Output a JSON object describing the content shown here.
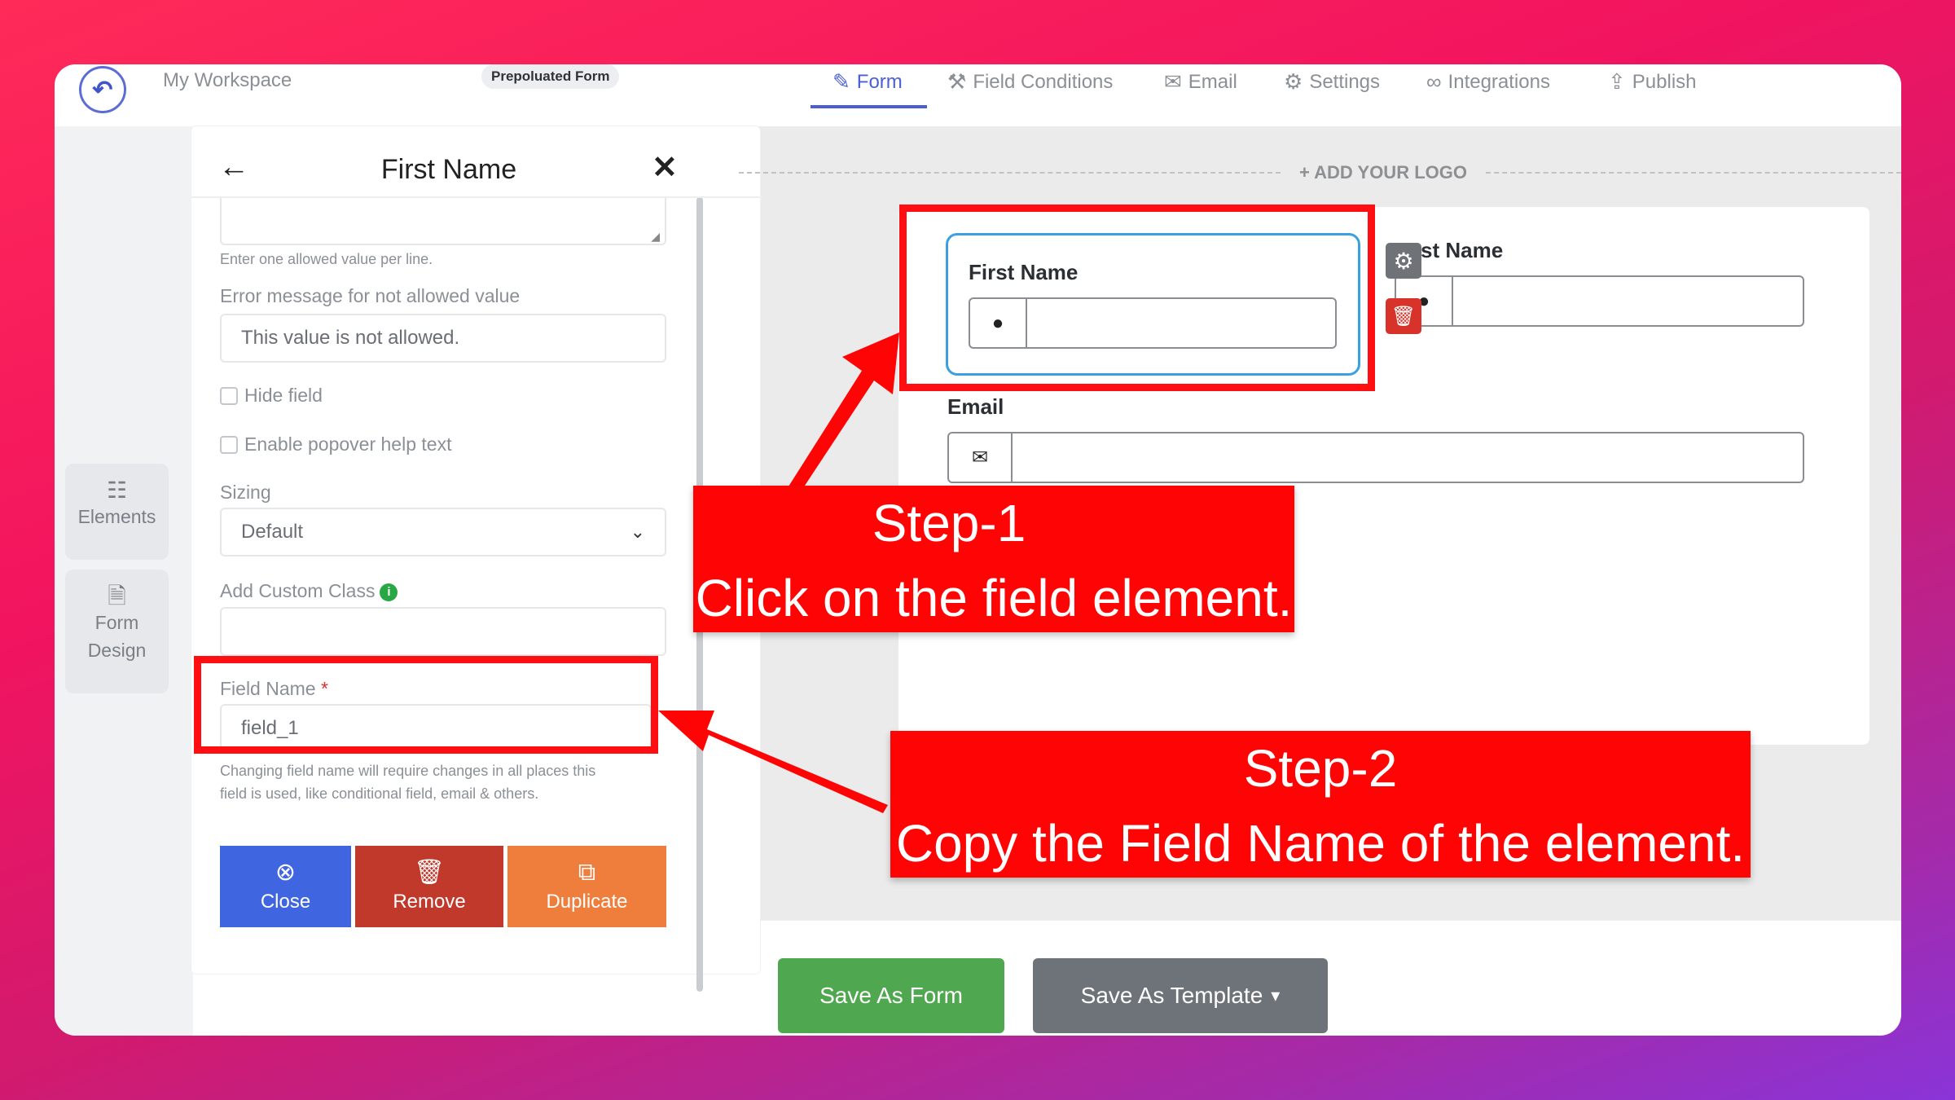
{
  "topbar": {
    "workspace": "My Workspace",
    "badge": "Prepoluated Form",
    "tabs": [
      {
        "label": "Form",
        "icon": "form-icon"
      },
      {
        "label": "Field Conditions",
        "icon": "wrench-icon"
      },
      {
        "label": "Email",
        "icon": "envelope-icon"
      },
      {
        "label": "Settings",
        "icon": "gear-icon"
      },
      {
        "label": "Integrations",
        "icon": "link-icon"
      },
      {
        "label": "Publish",
        "icon": "share-icon"
      }
    ],
    "active_tab": "Form"
  },
  "left_rail": {
    "elements": "Elements",
    "form_design_1": "Form",
    "form_design_2": "Design"
  },
  "panel": {
    "title": "First Name",
    "allowed_values_hint": "Enter one allowed value per line.",
    "error_label": "Error message for not allowed value",
    "error_value": "This value is not allowed.",
    "hide_field": "Hide field",
    "enable_popover": "Enable popover help text",
    "sizing_label": "Sizing",
    "sizing_value": "Default",
    "custom_class_label": "Add Custom Class",
    "field_name_label": "Field Name",
    "required_mark": "*",
    "field_name_value": "field_1",
    "field_name_hint_1": "Changing field name will require changes in all places this",
    "field_name_hint_2": "field is used, like conditional field, email & others.",
    "close": "Close",
    "remove": "Remove",
    "duplicate": "Duplicate"
  },
  "canvas": {
    "add_logo": "+ ADD YOUR LOGO",
    "first_name_label": "First Name",
    "last_name_label": "st Name",
    "email_label": "Email"
  },
  "footer": {
    "save_form": "Save As Form",
    "save_template": "Save As Template",
    "caret": "▾"
  },
  "annotations": {
    "step1_title": "Step-1",
    "step1_text": "Click on the field element.",
    "step2_title": "Step-2",
    "step2_text": "Copy the Field Name of the element."
  },
  "colors": {
    "accent": "#4a5fd6",
    "close_btn": "#3f66e0",
    "remove_btn": "#c0392b",
    "duplicate_btn": "#ef7d3c",
    "save_form_btn": "#4fa84f",
    "save_template_btn": "#6e7379",
    "annotation_red": "#ff0404"
  }
}
